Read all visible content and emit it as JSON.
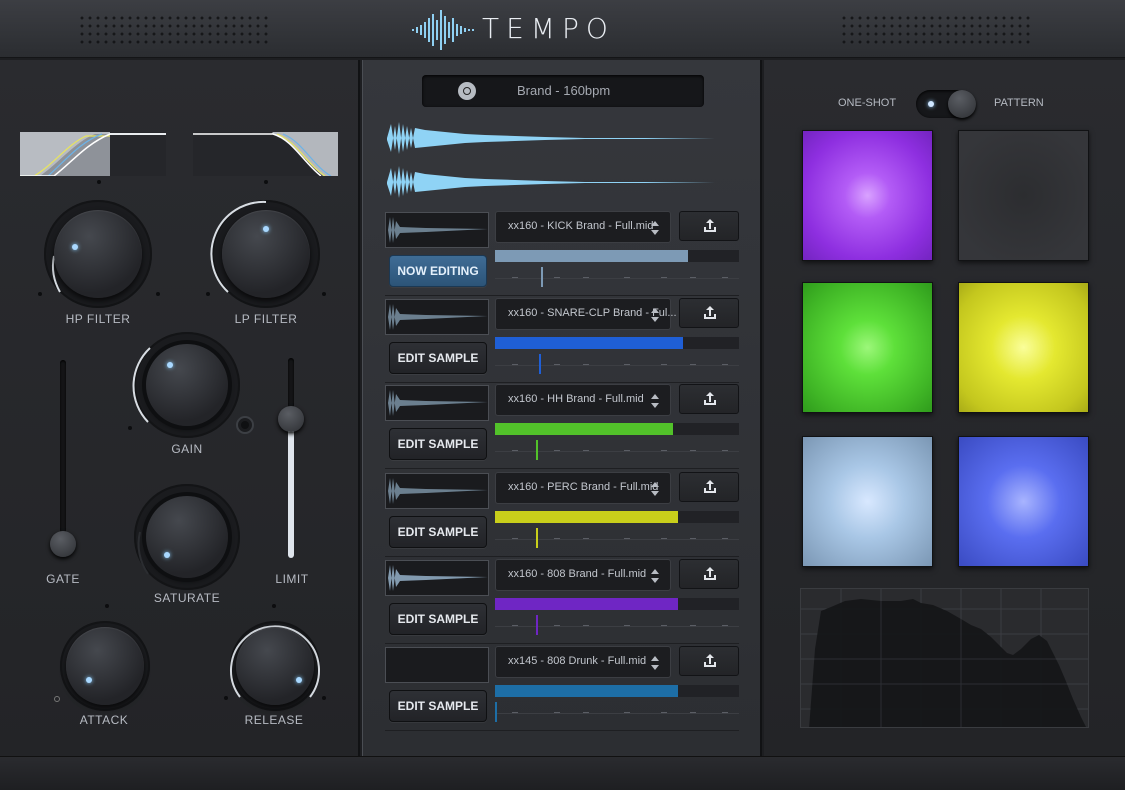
{
  "app": {
    "title": "TEMPO"
  },
  "left": {
    "hp_filter": "HP FILTER",
    "lp_filter": "LP FILTER",
    "gain": "GAIN",
    "gate": "GATE",
    "saturate": "SATURATE",
    "limit": "LIMIT",
    "attack": "ATTACK",
    "release": "RELEASE"
  },
  "search": {
    "value": "Brand - 160bpm"
  },
  "rows": [
    {
      "file": "xx160 - KICK Brand - Full.mid",
      "button": "NOW EDITING",
      "active": true,
      "color": "#7d9ab5",
      "fill": 0.79
    },
    {
      "file": "xx160 - SNARE-CLP Brand - Ful...",
      "button": "EDIT SAMPLE",
      "active": false,
      "color": "#1f5fd6",
      "fill": 0.77
    },
    {
      "file": "xx160 - HH Brand - Full.mid",
      "button": "EDIT SAMPLE",
      "active": false,
      "color": "#52c22a",
      "fill": 0.73
    },
    {
      "file": "xx160 - PERC Brand - Full.mid",
      "button": "EDIT SAMPLE",
      "active": false,
      "color": "#c9cf1b",
      "fill": 0.75
    },
    {
      "file": "xx160 - 808 Brand - Full.mid",
      "button": "EDIT SAMPLE",
      "active": false,
      "color": "#6f26c4",
      "fill": 0.75
    },
    {
      "file": "xx145 - 808 Drunk - Full.mid",
      "button": "EDIT SAMPLE",
      "active": false,
      "color": "#1d6ea6",
      "fill": 0.75
    }
  ],
  "right": {
    "one_shot": "ONE-SHOT",
    "pattern": "PATTERN",
    "pads": [
      {
        "name": "pad-1",
        "color": "#a040f0"
      },
      {
        "name": "pad-2",
        "color": "#2a2b2e"
      },
      {
        "name": "pad-3",
        "color": "#58e030"
      },
      {
        "name": "pad-4",
        "color": "#e4e830"
      },
      {
        "name": "pad-5",
        "color": "#a9c7e6"
      },
      {
        "name": "pad-6",
        "color": "#5468ea"
      }
    ]
  }
}
